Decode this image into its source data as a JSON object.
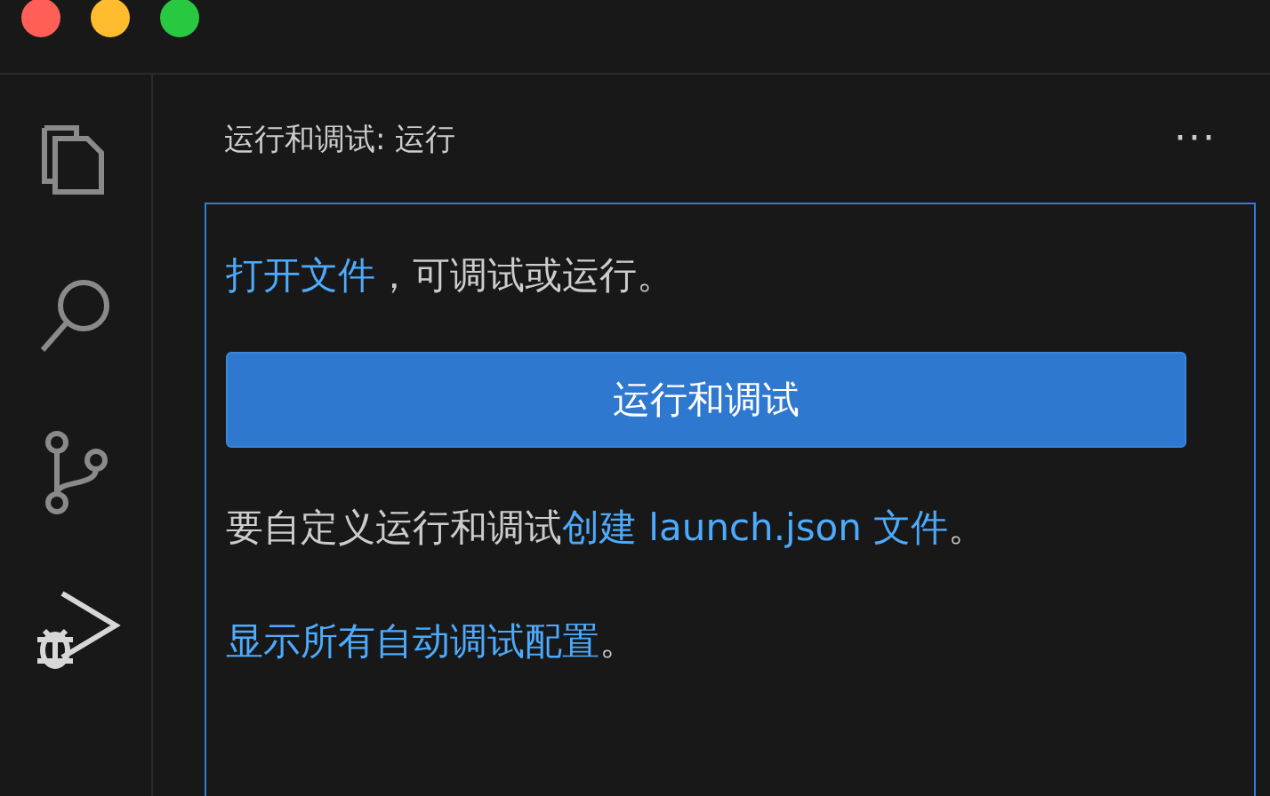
{
  "activity_bar": [
    {
      "kind": "files",
      "selected": false
    },
    {
      "kind": "search",
      "selected": false
    },
    {
      "kind": "source-control",
      "selected": false
    },
    {
      "kind": "run-debug",
      "selected": true
    }
  ],
  "sidebar": {
    "title": "运行和调试: 运行",
    "more": "···",
    "paragraphs": [
      {
        "parts": [
          {
            "kind": "link",
            "text": "打开文件"
          },
          {
            "kind": "text",
            "text": "，可调试或运行。"
          }
        ]
      }
    ],
    "button": "运行和调试",
    "notes": [
      {
        "parts": [
          {
            "kind": "text",
            "text": "要自定义运行和调试"
          },
          {
            "kind": "link",
            "text": "创建 launch.json 文件"
          },
          {
            "kind": "text",
            "text": "。"
          }
        ]
      },
      {
        "parts": [
          {
            "kind": "link",
            "text": "显示所有自动调试配置"
          },
          {
            "kind": "text",
            "text": "。"
          }
        ]
      }
    ]
  }
}
